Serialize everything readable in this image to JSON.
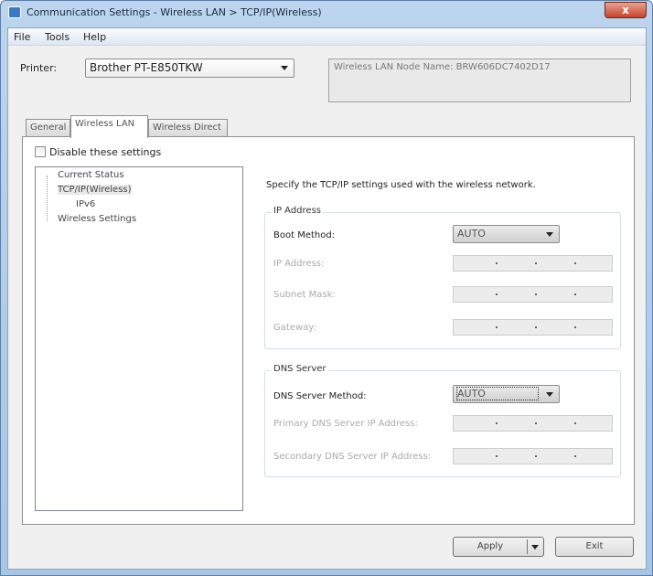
{
  "window": {
    "title": "Communication Settings - Wireless LAN > TCP/IP(Wireless)",
    "close_label": "x"
  },
  "menu": [
    "File",
    "Tools",
    "Help"
  ],
  "printer": {
    "label": "Printer:",
    "value": "Brother PT-E850TKW"
  },
  "node_name": "Wireless LAN Node Name: BRW606DC7402D17",
  "tabs": [
    {
      "label": "General"
    },
    {
      "label": "Wireless LAN",
      "active": true
    },
    {
      "label": "Wireless Direct"
    }
  ],
  "disable": {
    "label": "Disable these settings",
    "checked": false
  },
  "tree": [
    "Current Status",
    "TCP/IP(Wireless)",
    "IPv6",
    "Wireless Settings"
  ],
  "description": "Specify the TCP/IP settings used with the wireless network.",
  "ip_group": {
    "title": "IP Address",
    "boot_label": "Boot Method:",
    "boot_value": "AUTO",
    "ip_label": "IP Address:",
    "mask_label": "Subnet Mask:",
    "gateway_label": "Gateway:"
  },
  "dns_group": {
    "title": "DNS Server",
    "method_label": "DNS Server Method:",
    "method_value": "AUTO",
    "primary_label": "Primary DNS Server IP Address:",
    "secondary_label": "Secondary DNS Server IP Address:"
  },
  "buttons": {
    "apply": "Apply",
    "exit": "Exit"
  }
}
